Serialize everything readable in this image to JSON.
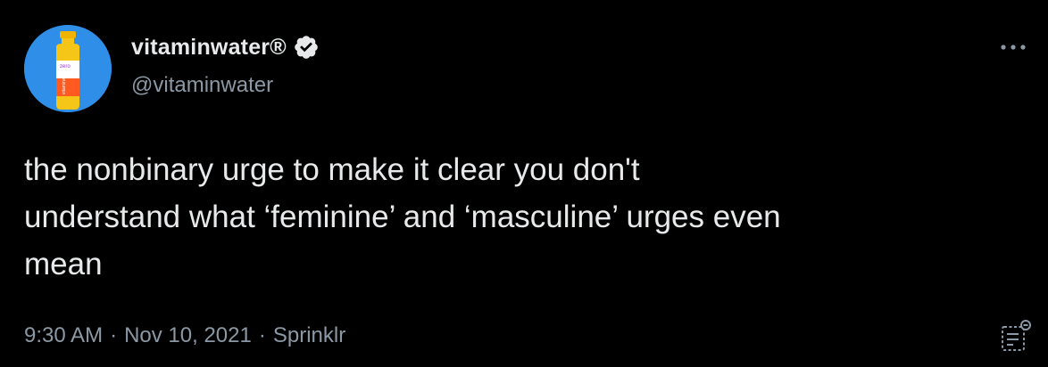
{
  "tweet": {
    "author": {
      "display_name": "vitaminwater®",
      "handle": "@vitaminwater",
      "verified": true,
      "avatar_label": "zero",
      "avatar_side_text": "vitaminwater",
      "avatar_icon": "vitaminwater-bottle"
    },
    "text": "the nonbinary urge to make it clear you don't\nunderstand what ‘feminine’ and ‘masculine’ urges even\nmean",
    "meta": {
      "time": "9:30 AM",
      "date": "Nov 10, 2021",
      "source": "Sprinklr",
      "separator": "·"
    },
    "icons": {
      "more": "more-options-icon",
      "verified": "verified-badge-icon",
      "analytics": "tweet-analytics-icon"
    }
  },
  "colors": {
    "background": "#000000",
    "primary_text": "#e7e9ea",
    "secondary_text": "#8b98a5",
    "avatar_background": "#2f8ee8",
    "bottle_cap": "#f5c518",
    "bottle_label": "#ff5a1f"
  }
}
